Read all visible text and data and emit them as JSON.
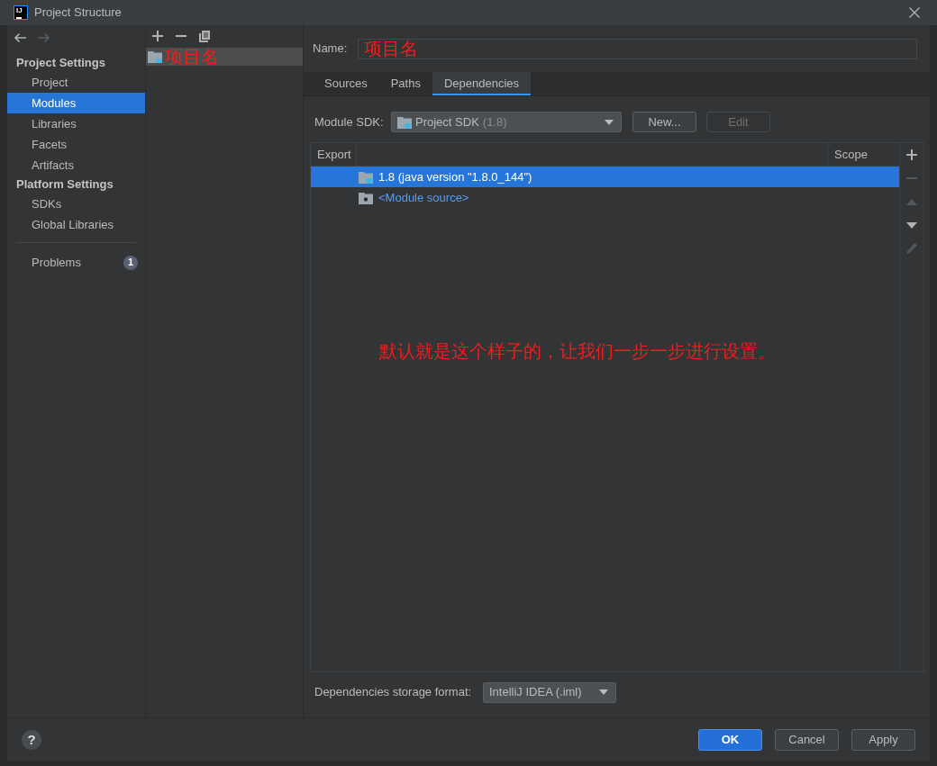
{
  "window": {
    "logo": "IJ",
    "title": "Project Structure"
  },
  "history": [
    {
      "kind": "back",
      "disabled": false
    },
    {
      "kind": "forward",
      "disabled": true
    }
  ],
  "sidebar": {
    "sections": [
      {
        "heading": "Project Settings",
        "items": [
          {
            "label": "Project",
            "selected": false
          },
          {
            "label": "Modules",
            "selected": true
          },
          {
            "label": "Libraries",
            "selected": false
          },
          {
            "label": "Facets",
            "selected": false
          },
          {
            "label": "Artifacts",
            "selected": false
          }
        ]
      },
      {
        "heading": "Platform Settings",
        "items": [
          {
            "label": "SDKs",
            "selected": false
          },
          {
            "label": "Global Libraries",
            "selected": false
          }
        ]
      }
    ],
    "problems": {
      "label": "Problems",
      "count": "1"
    }
  },
  "modules": {
    "items": [
      {
        "label": "项目名",
        "selected": true
      }
    ]
  },
  "name_field": {
    "label": "Name:",
    "value": "项目名"
  },
  "tabs": [
    {
      "label": "Sources",
      "selected": false
    },
    {
      "label": "Paths",
      "selected": false
    },
    {
      "label": "Dependencies",
      "selected": true
    }
  ],
  "module_sdk": {
    "label": "Module SDK:",
    "value": "Project SDK",
    "version": "(1.8)",
    "buttons": [
      {
        "label": "New...",
        "disabled": false
      },
      {
        "label": "Edit",
        "disabled": true
      }
    ]
  },
  "dependencies": {
    "columns": [
      "Export",
      "Scope"
    ],
    "rows": [
      {
        "kind": "sdk",
        "label": "1.8 (java version \"1.8.0_144\")",
        "selected": true
      },
      {
        "kind": "source",
        "label": "<Module source>",
        "selected": false
      }
    ],
    "toolbar": [
      {
        "kind": "add",
        "disabled": false
      },
      {
        "kind": "remove",
        "disabled": true
      },
      {
        "kind": "up",
        "disabled": true
      },
      {
        "kind": "down",
        "disabled": false
      },
      {
        "kind": "edit",
        "disabled": true
      }
    ]
  },
  "annotation": "默认就是这个样子的，让我们一步一步进行设置。",
  "storage_format": {
    "label": "Dependencies storage format:",
    "value": "IntelliJ IDEA (.iml)"
  },
  "help": "?",
  "buttons": [
    {
      "label": "OK",
      "kind": "primary"
    },
    {
      "label": "Cancel",
      "kind": "default"
    },
    {
      "label": "Apply",
      "kind": "default"
    }
  ]
}
